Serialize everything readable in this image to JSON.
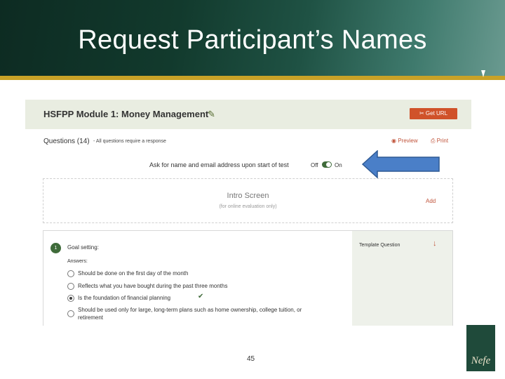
{
  "slide": {
    "title": "Request Participant’s Names",
    "page_number": "45",
    "logo_text": "Nefe"
  },
  "app": {
    "module_title": "HSFPP Module 1: Money Management",
    "get_url_label": "Get URL",
    "questions_label": "Questions (14)",
    "questions_note": "- All questions require a response",
    "preview_label": "Preview",
    "print_label": "Print",
    "ask_name_label": "Ask for name and email address upon start of test",
    "toggle_off": "Off",
    "toggle_on": "On",
    "intro": {
      "title": "Intro Screen",
      "subtitle": "(for online evaluation only)",
      "add_label": "Add"
    },
    "question": {
      "number": "1",
      "text": "Goal setting:",
      "answers_label": "Answers:",
      "answers": [
        "Should be done on the first day of the month",
        "Reflects what you have bought during the past three months",
        "Is the foundation of financial planning",
        "Should be used only for large, long-term plans such as home ownership, college tuition, or retirement"
      ],
      "selected_index": 2,
      "template_label": "Template Question"
    }
  },
  "colors": {
    "header_dark": "#0d2b22",
    "gold": "#c9a227",
    "accent_orange": "#d0522a",
    "green": "#3f6b3a",
    "arrow_blue": "#4a7fc8"
  }
}
